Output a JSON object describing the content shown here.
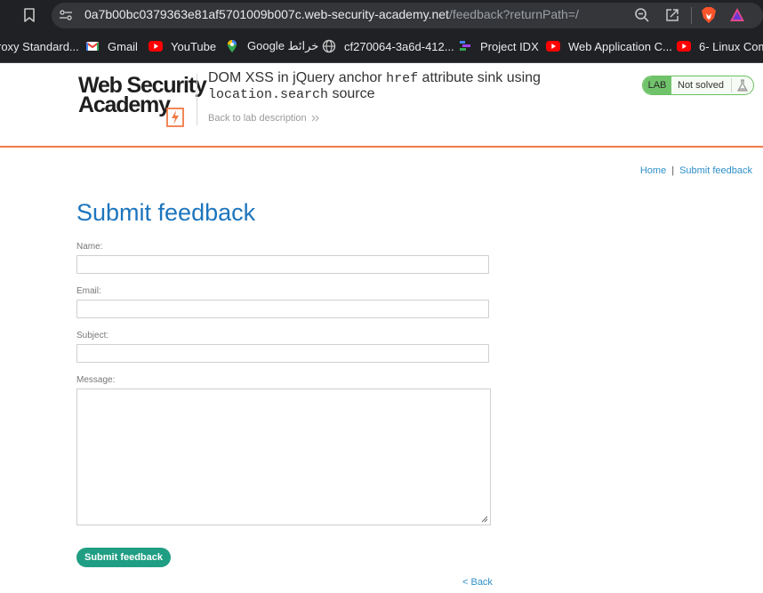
{
  "browser": {
    "url_domain": "0a7b00bc0379363e81af5701009b007c.web-security-academy.net",
    "url_path": "/feedback?returnPath=/",
    "bookmarks": [
      {
        "label": "roxy Standard...",
        "icon": "page-icon"
      },
      {
        "label": "Gmail",
        "icon": "gmail-icon"
      },
      {
        "label": "YouTube",
        "icon": "youtube-icon"
      },
      {
        "label": "Google خرائط",
        "icon": "google-maps-icon"
      },
      {
        "label": "cf270064-3a6d-412...",
        "icon": "globe-icon"
      },
      {
        "label": "Project IDX",
        "icon": "project-idx-icon"
      },
      {
        "label": "Web Application C...",
        "icon": "youtube-icon"
      },
      {
        "label": "6- Linux Comm",
        "icon": "youtube-icon"
      }
    ]
  },
  "lab": {
    "logo_line1": "Web Security",
    "logo_line2": "Academy",
    "title_part1": "DOM XSS in jQuery anchor ",
    "title_code1": "href",
    "title_part2": " attribute sink using",
    "title_code2": "location.search",
    "title_part3": " source",
    "back_to_description": "Back to lab description",
    "status_badge": "LAB",
    "status_text": "Not solved"
  },
  "nav": {
    "home": "Home",
    "separator": "|",
    "submit_feedback": "Submit feedback"
  },
  "page": {
    "title": "Submit feedback",
    "fields": {
      "name_label": "Name:",
      "email_label": "Email:",
      "subject_label": "Subject:",
      "message_label": "Message:",
      "name_value": "",
      "email_value": "",
      "subject_value": "",
      "message_value": ""
    },
    "submit_label": "Submit feedback",
    "back_link": "< Back"
  },
  "colors": {
    "accent_orange": "#f07a45",
    "title_blue": "#1d75bd",
    "link_blue": "#2e8fc9",
    "button_teal": "#1f9e84",
    "status_green": "#70c36a"
  }
}
